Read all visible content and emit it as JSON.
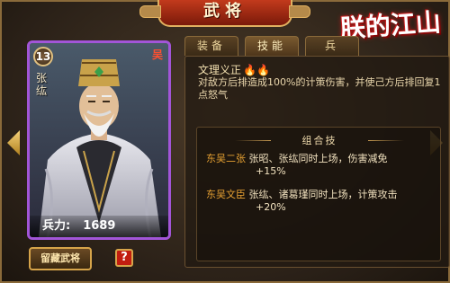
{
  "header": {
    "title": "武将"
  },
  "logo": {
    "text": "朕的江山"
  },
  "hero": {
    "level": "13",
    "faction": "吴",
    "name": "张纮",
    "troops_label": "兵力:",
    "troops_value": "1689",
    "card_border_color": "#a255d8"
  },
  "tabs": [
    {
      "label": "装备"
    },
    {
      "label": "技能"
    },
    {
      "label": "兵"
    }
  ],
  "active_tab": "技能",
  "skill": {
    "name": "文理义正",
    "flames": "🔥🔥",
    "description": "对敌方后排造成100%的计策伤害，并使己方后排回复1点怒气"
  },
  "combos": {
    "title": "组合技",
    "items": [
      {
        "name": "东吴二张",
        "text": "张昭、张纮同时上场，伤害减免",
        "bonus": "+15%"
      },
      {
        "name": "东吴文臣",
        "text": "张纮、诸葛瑾同时上场，计策攻击",
        "bonus": "+20%"
      }
    ]
  },
  "buttons": {
    "collection": "留藏武将",
    "help": "?"
  },
  "icons": {
    "nav_left": "chevron-left-icon",
    "nav_right": "chevron-right-icon"
  }
}
